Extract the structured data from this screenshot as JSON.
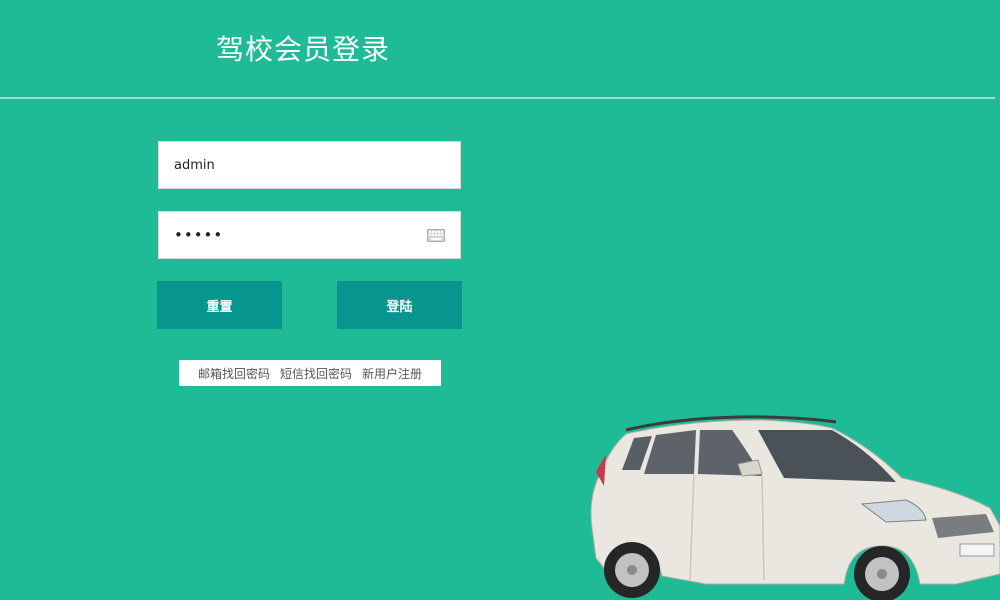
{
  "header": {
    "title": "驾校会员登录"
  },
  "form": {
    "username_value": "admin",
    "password_value": "12345",
    "reset_label": "重置",
    "login_label": "登陆"
  },
  "links": {
    "email_recover": "邮箱找回密码",
    "sms_recover": "短信找回密码",
    "register": "新用户注册"
  },
  "icons": {
    "password_field": "keyboard-icon",
    "illustration": "car-image"
  },
  "colors": {
    "background": "#1fbb96",
    "button": "#06958f",
    "divider": "#8fe3cf",
    "text_on_background": "#ffffff"
  }
}
